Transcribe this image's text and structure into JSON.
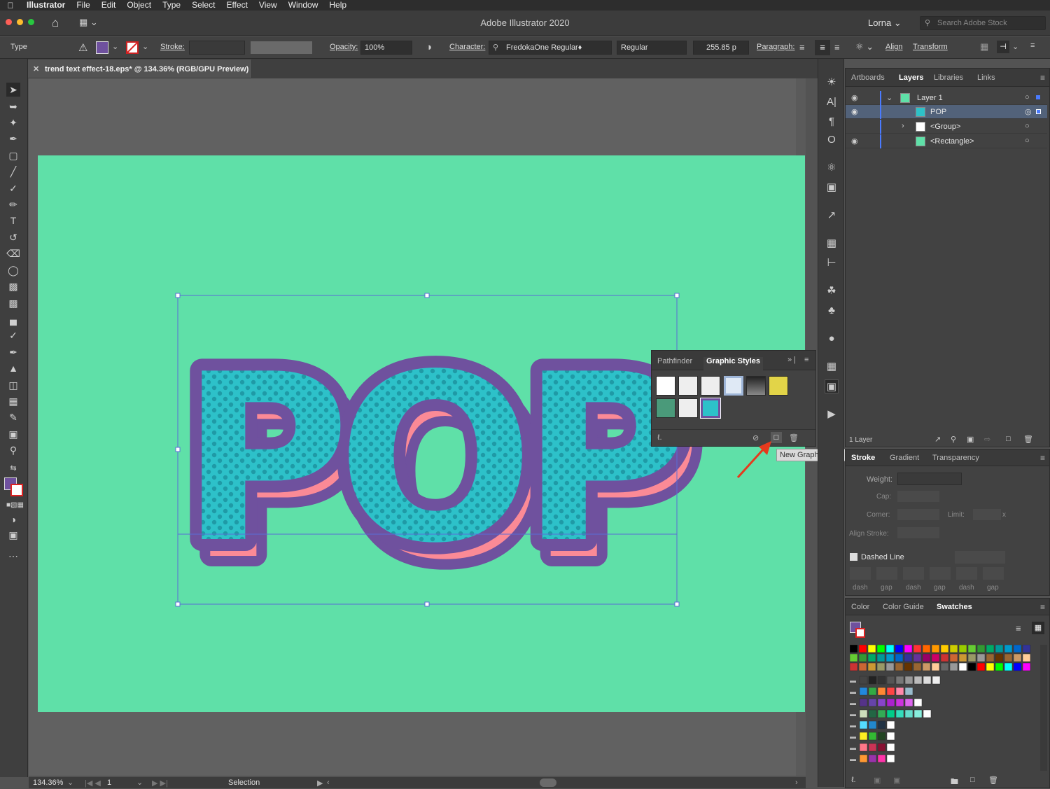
{
  "menubar": {
    "app": "Illustrator",
    "items": [
      "File",
      "Edit",
      "Object",
      "Type",
      "Select",
      "Effect",
      "View",
      "Window",
      "Help"
    ]
  },
  "titlebar": {
    "title": "Adobe Illustrator 2020",
    "user": "Lorna",
    "stock_placeholder": "Search Adobe Stock"
  },
  "controlbar": {
    "mode": "Type",
    "stroke_label": "Stroke:",
    "opacity_label": "Opacity:",
    "opacity_value": "100%",
    "character_label": "Character:",
    "font_family": "FredokaOne Regular♦",
    "font_style": "Regular",
    "font_size": "255.85 p",
    "paragraph_label": "Paragraph:",
    "align_label": "Align",
    "transform_label": "Transform"
  },
  "document": {
    "tab_title": "trend text effect-18.eps* @ 134.36% (RGB/GPU Preview)",
    "artwork_text": "POP"
  },
  "colors": {
    "artboard": "#5fe0a8",
    "outline": "#6f519e",
    "shadow": "#fb8a96",
    "fill": "#2dc1c9",
    "dots": "#1f9aa6",
    "selection": "#5a6dd6",
    "arrow": "#e53a1d"
  },
  "layers_panel": {
    "tabs": [
      "Artboards",
      "Layers",
      "Libraries",
      "Links"
    ],
    "active_tab": "Layers",
    "rows": [
      {
        "name": "Layer 1"
      },
      {
        "name": "POP"
      },
      {
        "name": "<Group>"
      },
      {
        "name": "<Rectangle>"
      }
    ],
    "footer": "1 Layer"
  },
  "graphic_styles_panel": {
    "tabs": [
      "Pathfinder",
      "Graphic Styles"
    ],
    "active_tab": "Graphic Styles",
    "tooltip": "New Graphic Style"
  },
  "stroke_panel": {
    "tabs": [
      "Stroke",
      "Gradient",
      "Transparency"
    ],
    "active_tab": "Stroke",
    "weight_label": "Weight:",
    "cap_label": "Cap:",
    "corner_label": "Corner:",
    "limit_label": "Limit:",
    "limit_suffix": "x",
    "align_stroke_label": "Align Stroke:",
    "dashed_line_label": "Dashed Line",
    "dash_labels": [
      "dash",
      "gap",
      "dash",
      "gap",
      "dash",
      "gap"
    ]
  },
  "swatches_panel": {
    "tabs": [
      "Color",
      "Color Guide",
      "Swatches"
    ],
    "active_tab": "Swatches"
  },
  "statusbar": {
    "zoom": "134.36%",
    "artboard_number": "1",
    "tool": "Selection"
  }
}
